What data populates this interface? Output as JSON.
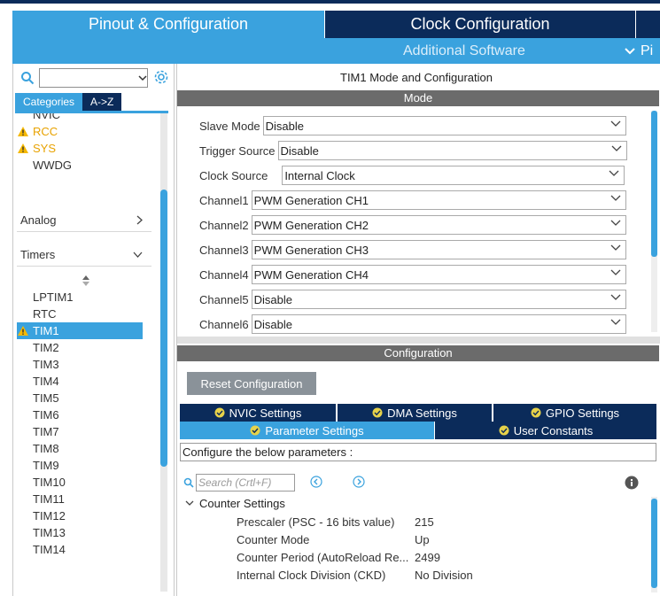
{
  "top_tabs": {
    "pinout": "Pinout & Configuration",
    "clock": "Clock Configuration",
    "additional": "Additional Software",
    "pinout_view": "Pi"
  },
  "sidebar": {
    "search_value": "",
    "cat_tabs": [
      "Categories",
      "A->Z"
    ],
    "items": {
      "nvic": "NVIC",
      "rcc": "RCC",
      "sys": "SYS",
      "wwdg": "WWDG",
      "analog": "Analog",
      "timers": "Timers",
      "lptim1": "LPTIM1",
      "rtc": "RTC",
      "tim1": "TIM1",
      "tim2": "TIM2",
      "tim3": "TIM3",
      "tim4": "TIM4",
      "tim5": "TIM5",
      "tim6": "TIM6",
      "tim7": "TIM7",
      "tim8": "TIM8",
      "tim9": "TIM9",
      "tim10": "TIM10",
      "tim11": "TIM11",
      "tim12": "TIM12",
      "tim13": "TIM13",
      "tim14": "TIM14"
    }
  },
  "main": {
    "title": "TIM1 Mode and Configuration",
    "mode_header": "Mode",
    "mode_rows": {
      "slave_mode": {
        "label": "Slave Mode",
        "value": "Disable"
      },
      "trigger_source": {
        "label": "Trigger Source",
        "value": "Disable"
      },
      "clock_source": {
        "label": "Clock Source",
        "value": "Internal Clock"
      },
      "channel1": {
        "label": "Channel1",
        "value": "PWM Generation CH1"
      },
      "channel2": {
        "label": "Channel2",
        "value": "PWM Generation CH2"
      },
      "channel3": {
        "label": "Channel3",
        "value": "PWM Generation CH3"
      },
      "channel4": {
        "label": "Channel4",
        "value": "PWM Generation CH4"
      },
      "channel5": {
        "label": "Channel5",
        "value": "Disable"
      },
      "channel6": {
        "label": "Channel6",
        "value": "Disable"
      }
    },
    "config_header": "Configuration",
    "reset_button": "Reset Configuration",
    "settings_tabs": {
      "nvic": "NVIC Settings",
      "dma": "DMA Settings",
      "gpio": "GPIO Settings",
      "parameter": "Parameter Settings",
      "user_constants": "User Constants"
    },
    "description": "Configure the below parameters :",
    "param_search_placeholder": "Search (Crtl+F)",
    "counter_settings": "Counter Settings",
    "params": {
      "prescaler": {
        "name": "Prescaler (PSC - 16 bits value)",
        "value": "215"
      },
      "counter_mode": {
        "name": "Counter Mode",
        "value": "Up"
      },
      "counter_period": {
        "name": "Counter Period (AutoReload Re...",
        "value": "2499"
      },
      "clock_division": {
        "name": "Internal Clock Division (CKD)",
        "value": "No Division"
      }
    }
  },
  "colors": {
    "accent": "#3aa2de",
    "dark_navy": "#0b2b5a",
    "section_gray": "#6b6b6b",
    "warning": "#f5b800"
  }
}
